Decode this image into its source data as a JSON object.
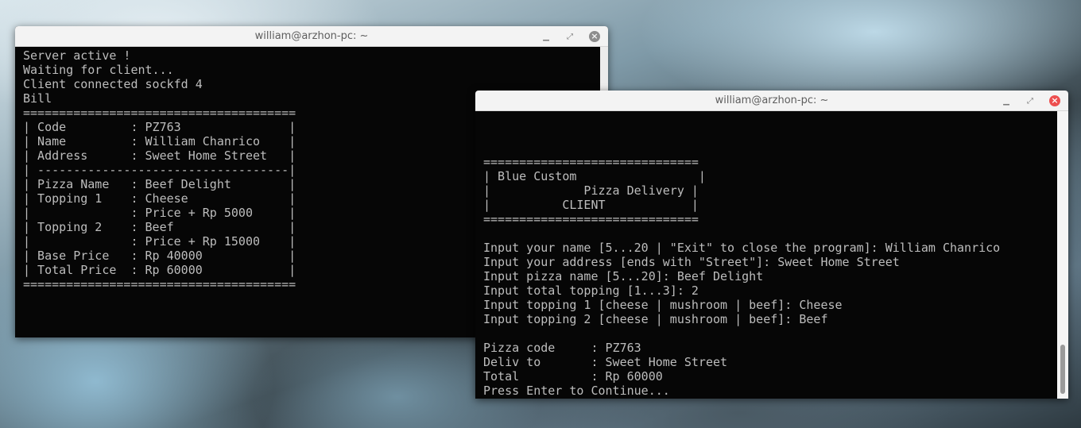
{
  "server_window": {
    "title": "william@arzhon-pc: ~",
    "buttons": {
      "minimize": "▁",
      "maximize": "⤢",
      "close": "×"
    },
    "lines": [
      "Server active !",
      "Waiting for client...",
      "Client connected sockfd 4",
      "Bill",
      "======================================",
      "| Code         : PZ763               |",
      "| Name         : William Chanrico    |",
      "| Address      : Sweet Home Street   |",
      "| -----------------------------------|",
      "| Pizza Name   : Beef Delight        |",
      "| Topping 1    : Cheese              |",
      "|              : Price + Rp 5000     |",
      "| Topping 2    : Beef                |",
      "|              : Price + Rp 15000    |",
      "| Base Price   : Rp 40000            |",
      "| Total Price  : Rp 60000            |",
      "======================================"
    ]
  },
  "client_window": {
    "title": "william@arzhon-pc: ~",
    "buttons": {
      "minimize": "▁",
      "maximize": "⤢",
      "close": "×"
    },
    "lines": [
      "",
      "",
      "",
      "==============================",
      "| Blue Custom                 |",
      "|             Pizza Delivery |",
      "|          CLIENT            |",
      "==============================",
      "",
      "Input your name [5...20 | \"Exit\" to close the program]: William Chanrico",
      "Input your address [ends with \"Street\"]: Sweet Home Street",
      "Input pizza name [5...20]: Beef Delight",
      "Input total topping [1...3]: 2",
      "Input topping 1 [cheese | mushroom | beef]: Cheese",
      "Input topping 2 [cheese | mushroom | beef]: Beef",
      "",
      "Pizza code     : PZ763",
      "Deliv to       : Sweet Home Street",
      "Total          : Rp 60000",
      "Press Enter to Continue..."
    ]
  }
}
